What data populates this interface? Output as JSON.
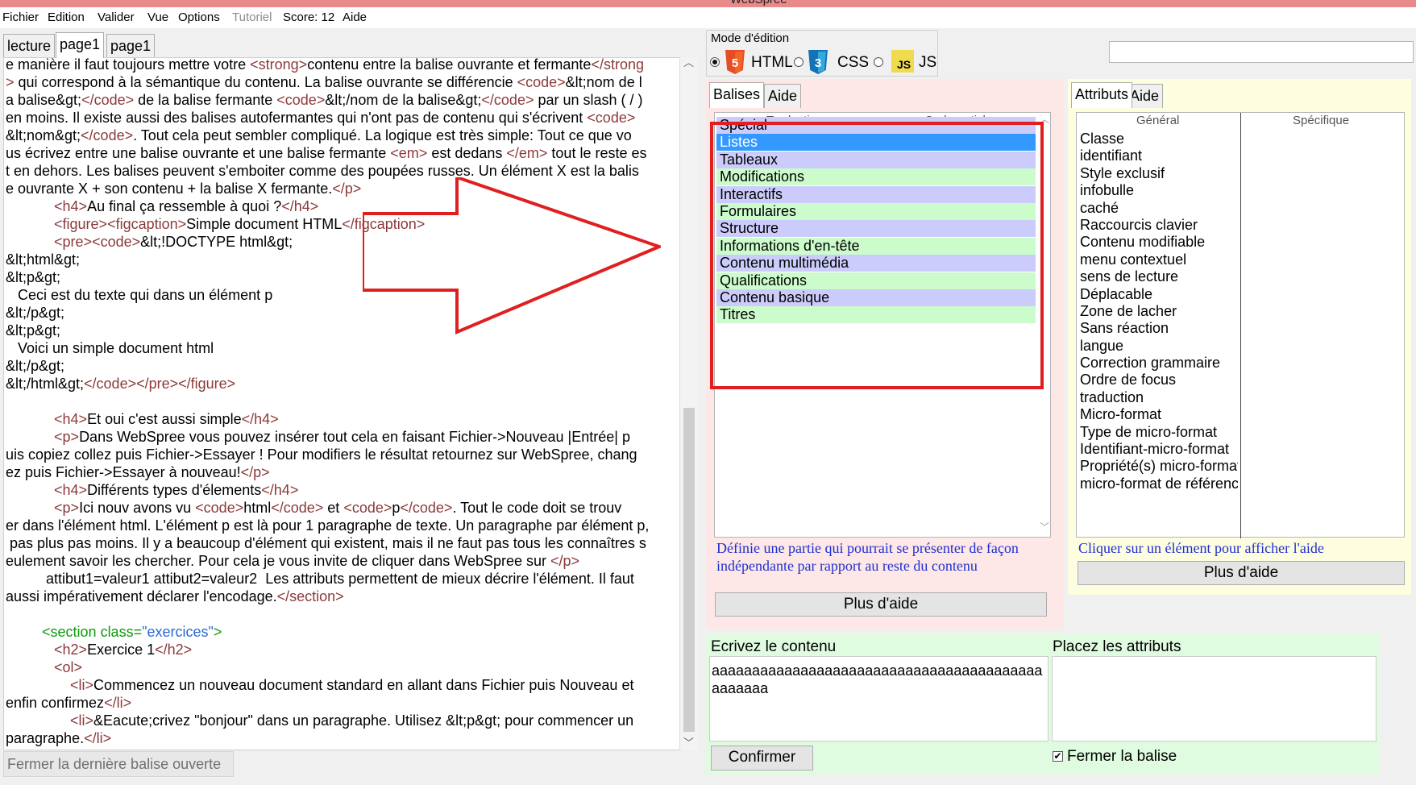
{
  "window": {
    "title": "WebSpree"
  },
  "menu": [
    {
      "label": "Fichier",
      "enabled": true
    },
    {
      "label": "Edition",
      "enabled": true
    },
    {
      "label": "Valider",
      "enabled": true
    },
    {
      "label": "Vue",
      "enabled": true
    },
    {
      "label": "Options",
      "enabled": true
    },
    {
      "label": "Tutoriel",
      "enabled": false
    },
    {
      "label": "Score: 12",
      "enabled": true
    },
    {
      "label": "Aide",
      "enabled": true
    }
  ],
  "editor": {
    "tabs": [
      "lecture",
      "page1",
      "page1"
    ],
    "active_tab": 1,
    "close_last_label": "Fermer la dernière balise ouverte",
    "lines": [
      [
        {
          "t": "e manière il faut toujours mettre votre "
        },
        {
          "t": "<strong>",
          "c": "tg"
        },
        {
          "t": "contenu entre la balise ouvrante et fermante"
        },
        {
          "t": "</strong",
          "c": "tg"
        }
      ],
      [
        {
          "t": ">",
          "c": "tg"
        },
        {
          "t": " qui correspond à la sémantique du contenu. La balise ouvrante se différencie "
        },
        {
          "t": "<code>",
          "c": "tg"
        },
        {
          "t": "&lt;nom de l"
        }
      ],
      [
        {
          "t": "a balise&gt;"
        },
        {
          "t": "</code>",
          "c": "tg"
        },
        {
          "t": " de la balise fermante "
        },
        {
          "t": "<code>",
          "c": "tg"
        },
        {
          "t": "&lt;/nom de la balise&gt;"
        },
        {
          "t": "</code>",
          "c": "tg"
        },
        {
          "t": " par un slash ( / )"
        }
      ],
      [
        {
          "t": "en moins. Il existe aussi des balises autofermantes qui n'ont pas de contenu qui s'écrivent "
        },
        {
          "t": "<code>",
          "c": "tg"
        }
      ],
      [
        {
          "t": "&lt;nom&gt;"
        },
        {
          "t": "</code>",
          "c": "tg"
        },
        {
          "t": ". Tout cela peut sembler compliqué. La logique est très simple: Tout ce que vo"
        }
      ],
      [
        {
          "t": "us écrivez entre une balise ouvrante et une balise fermante "
        },
        {
          "t": "<em>",
          "c": "tg"
        },
        {
          "t": " est dedans "
        },
        {
          "t": "</em>",
          "c": "tg"
        },
        {
          "t": " tout le reste es"
        }
      ],
      [
        {
          "t": "t en dehors. Les balises peuvent s'emboiter comme des poupées russes. Un élément X est la balis"
        }
      ],
      [
        {
          "t": "e ouvrante X + son contenu + la balise X fermante."
        },
        {
          "t": "</p>",
          "c": "tg"
        }
      ],
      [
        {
          "t": "            "
        },
        {
          "t": "<h4>",
          "c": "tg"
        },
        {
          "t": "Au final ça ressemble à quoi ?"
        },
        {
          "t": "</h4>",
          "c": "tg"
        }
      ],
      [
        {
          "t": "            "
        },
        {
          "t": "<figure><figcaption>",
          "c": "tg"
        },
        {
          "t": "Simple document HTML"
        },
        {
          "t": "</figcaption>",
          "c": "tg"
        }
      ],
      [
        {
          "t": "            "
        },
        {
          "t": "<pre><code>",
          "c": "tg"
        },
        {
          "t": "&lt;!DOCTYPE html&gt;"
        }
      ],
      [
        {
          "t": "&lt;html&gt;"
        }
      ],
      [
        {
          "t": "&lt;p&gt;"
        }
      ],
      [
        {
          "t": "   Ceci est du texte qui dans un élément p"
        }
      ],
      [
        {
          "t": "&lt;/p&gt;"
        }
      ],
      [
        {
          "t": "&lt;p&gt;"
        }
      ],
      [
        {
          "t": "   Voici un simple document html"
        }
      ],
      [
        {
          "t": "&lt;/p&gt;"
        }
      ],
      [
        {
          "t": "&lt;/html&gt;"
        },
        {
          "t": "</code></pre></figure>",
          "c": "tg"
        }
      ],
      [
        {
          "t": ""
        }
      ],
      [
        {
          "t": "            "
        },
        {
          "t": "<h4>",
          "c": "tg"
        },
        {
          "t": "Et oui c'est aussi simple"
        },
        {
          "t": "</h4>",
          "c": "tg"
        }
      ],
      [
        {
          "t": "            "
        },
        {
          "t": "<p>",
          "c": "tg"
        },
        {
          "t": "Dans WebSpree vous pouvez insérer tout cela en faisant Fichier->Nouveau |Entrée| p"
        }
      ],
      [
        {
          "t": "uis copiez collez puis Fichier->Essayer ! Pour modifiers le résultat retournez sur WebSpree, chang"
        }
      ],
      [
        {
          "t": "ez puis Fichier->Essayer à nouveau!"
        },
        {
          "t": "</p>",
          "c": "tg"
        }
      ],
      [
        {
          "t": "            "
        },
        {
          "t": "<h4>",
          "c": "tg"
        },
        {
          "t": "Différents types d'élements"
        },
        {
          "t": "</h4>",
          "c": "tg"
        }
      ],
      [
        {
          "t": "            "
        },
        {
          "t": "<p>",
          "c": "tg"
        },
        {
          "t": "Ici nouv avons vu "
        },
        {
          "t": "<code>",
          "c": "tg"
        },
        {
          "t": "html"
        },
        {
          "t": "</code>",
          "c": "tg"
        },
        {
          "t": " et "
        },
        {
          "t": "<code>",
          "c": "tg"
        },
        {
          "t": "p"
        },
        {
          "t": "</code>",
          "c": "tg"
        },
        {
          "t": ". Tout le code doit se trouv"
        }
      ],
      [
        {
          "t": "er dans l'élément html. L'élément p est là pour 1 paragraphe de texte. Un paragraphe par élément p,"
        }
      ],
      [
        {
          "t": " pas plus pas moins. Il y a beaucoup d'élément qui existent, mais il ne faut pas tous les connaîtres s"
        }
      ],
      [
        {
          "t": "eulement savoir les chercher. Pour cela je vous invite de cliquer dans WebSpree sur "
        },
        {
          "t": "</p>",
          "c": "tg"
        }
      ],
      [
        {
          "t": "          attibut1=valeur1 attibut2=valeur2  Les attributs permettent de mieux décrire l'élément. Il faut"
        }
      ],
      [
        {
          "t": "aussi impérativement déclarer l'encodage."
        },
        {
          "t": "</section>",
          "c": "tg"
        }
      ],
      [
        {
          "t": ""
        }
      ],
      [
        {
          "t": "         "
        },
        {
          "t": "<section ",
          "c": "gr"
        },
        {
          "t": "class",
          "c": "gr"
        },
        {
          "t": "=",
          "c": "gr"
        },
        {
          "t": "\"exercices\"",
          "c": "bl"
        },
        {
          "t": ">",
          "c": "gr"
        }
      ],
      [
        {
          "t": "            "
        },
        {
          "t": "<h2>",
          "c": "tg"
        },
        {
          "t": "Exercice 1"
        },
        {
          "t": "</h2>",
          "c": "tg"
        }
      ],
      [
        {
          "t": "            "
        },
        {
          "t": "<ol>",
          "c": "tg"
        }
      ],
      [
        {
          "t": "                "
        },
        {
          "t": "<li>",
          "c": "tg"
        },
        {
          "t": "Commencez un nouveau document standard en allant dans Fichier puis Nouveau et"
        }
      ],
      [
        {
          "t": "enfin confirmez"
        },
        {
          "t": "</li>",
          "c": "tg"
        }
      ],
      [
        {
          "t": "                "
        },
        {
          "t": "<li>",
          "c": "tg"
        },
        {
          "t": "&Eacute;crivez \"bonjour\" dans un paragraphe. Utilisez &lt;p&gt; pour commencer un"
        }
      ],
      [
        {
          "t": "paragraphe."
        },
        {
          "t": "</li>",
          "c": "tg"
        }
      ]
    ]
  },
  "mode": {
    "label": "Mode d'édition",
    "options": [
      {
        "label": "HTML",
        "icon": "html5-icon",
        "color": "#e44d26",
        "selected": true
      },
      {
        "label": "CSS",
        "icon": "css3-icon",
        "color": "#1572b6",
        "selected": false
      },
      {
        "label": "JS",
        "icon": "js-icon",
        "color": "#f0db4f",
        "selected": false
      }
    ]
  },
  "search": {
    "value": ""
  },
  "balises": {
    "tabs": [
      "Balises",
      "Aide"
    ],
    "columns": [
      "Traduction",
      "Code, article"
    ],
    "items": [
      {
        "label": "Spécial",
        "color": "blue"
      },
      {
        "label": "Listes",
        "color": "selected"
      },
      {
        "label": "Tableaux",
        "color": "blue"
      },
      {
        "label": "Modifications",
        "color": "green"
      },
      {
        "label": "Interactifs",
        "color": "blue"
      },
      {
        "label": "Formulaires",
        "color": "green"
      },
      {
        "label": "Structure",
        "color": "blue"
      },
      {
        "label": "Informations d'en-tête",
        "color": "green"
      },
      {
        "label": "Contenu multimédia",
        "color": "blue"
      },
      {
        "label": "Qualifications",
        "color": "green"
      },
      {
        "label": "Contenu basique",
        "color": "blue"
      },
      {
        "label": "Titres",
        "color": "green"
      }
    ],
    "help_text": "Définie une partie qui pourrait se présenter de façon indépendante par rapport au reste du contenu",
    "more_help": "Plus d'aide"
  },
  "attributes": {
    "tabs": [
      "Attributs",
      "Aide"
    ],
    "columns": [
      "Général",
      "Spécifique"
    ],
    "general": [
      "Classe",
      "identifiant",
      "Style exclusif",
      "infobulle",
      "caché",
      "Raccourcis clavier",
      "Contenu modifiable",
      "menu contextuel",
      "sens de lecture",
      "Déplacable",
      "Zone de lacher",
      "Sans réaction",
      "langue",
      "Correction grammaire",
      "Ordre de focus",
      "traduction",
      "Micro-format",
      "Type de micro-format",
      "Identifiant-micro-format",
      "Propriété(s) micro-format",
      "micro-format de référence"
    ],
    "help_text": "Cliquer sur un élément pour afficher l'aide",
    "more_help": "Plus d'aide"
  },
  "bottom": {
    "content_label": "Ecrivez le contenu",
    "content_value": "aaaaaaaaaaaaaaaaaaaaaaaaaaaaaaaaaaaaaaaaaaaaaaaa",
    "attrs_label": "Placez les attributs",
    "confirm_label": "Confirmer",
    "close_tag_label": "Fermer la balise",
    "close_tag_checked": true
  },
  "colors": {
    "annotation": "#e02020",
    "list_blue": "#ccccfc",
    "list_green": "#ccfccc",
    "list_selected": "#3399ff"
  }
}
